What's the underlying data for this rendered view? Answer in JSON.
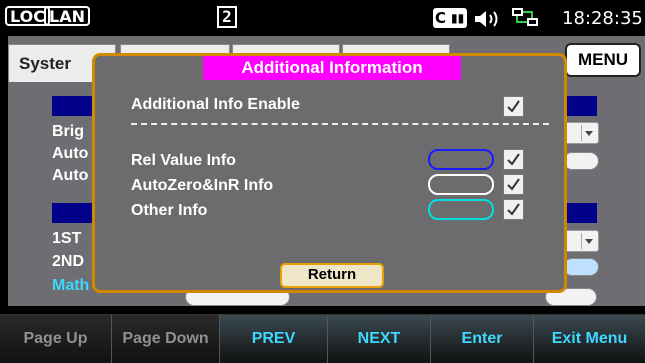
{
  "status_bar": {
    "loc": "LOC",
    "lan": "LAN",
    "page_number": "2",
    "time": "18:28:35"
  },
  "background": {
    "tab_label": "Syster",
    "menu_button": "MENU",
    "labels": [
      "Brig",
      "Auto",
      "Auto",
      "1ST",
      "2ND",
      "Math"
    ]
  },
  "dialog": {
    "title": "Additional Information",
    "enable_label": "Additional Info Enable",
    "separator": "------------------------------------------------",
    "rows": [
      {
        "label": "Rel Value Info",
        "color": "#1a1aff",
        "checked": true
      },
      {
        "label": "AutoZero&InR Info",
        "color": "#ffffff",
        "checked": true
      },
      {
        "label": "Other Info",
        "color": "#00e0e0",
        "checked": true
      }
    ],
    "return_label": "Return"
  },
  "softkeys": [
    "Page Up",
    "Page Down",
    "PREV",
    "NEXT",
    "Enter",
    "Exit Menu"
  ],
  "icons": {
    "card": "card-icon",
    "speaker": "speaker-icon",
    "network": "network-icon"
  }
}
